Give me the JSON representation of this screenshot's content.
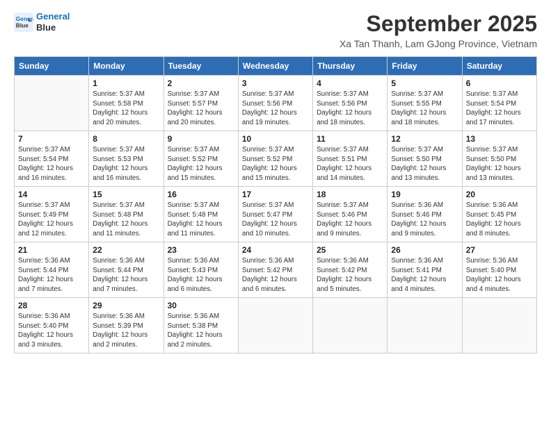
{
  "header": {
    "logo_line1": "General",
    "logo_line2": "Blue",
    "month_title": "September 2025",
    "subtitle": "Xa Tan Thanh, Lam GJong Province, Vietnam"
  },
  "days_of_week": [
    "Sunday",
    "Monday",
    "Tuesday",
    "Wednesday",
    "Thursday",
    "Friday",
    "Saturday"
  ],
  "weeks": [
    [
      {
        "day": "",
        "info": ""
      },
      {
        "day": "1",
        "info": "Sunrise: 5:37 AM\nSunset: 5:58 PM\nDaylight: 12 hours\nand 20 minutes."
      },
      {
        "day": "2",
        "info": "Sunrise: 5:37 AM\nSunset: 5:57 PM\nDaylight: 12 hours\nand 20 minutes."
      },
      {
        "day": "3",
        "info": "Sunrise: 5:37 AM\nSunset: 5:56 PM\nDaylight: 12 hours\nand 19 minutes."
      },
      {
        "day": "4",
        "info": "Sunrise: 5:37 AM\nSunset: 5:56 PM\nDaylight: 12 hours\nand 18 minutes."
      },
      {
        "day": "5",
        "info": "Sunrise: 5:37 AM\nSunset: 5:55 PM\nDaylight: 12 hours\nand 18 minutes."
      },
      {
        "day": "6",
        "info": "Sunrise: 5:37 AM\nSunset: 5:54 PM\nDaylight: 12 hours\nand 17 minutes."
      }
    ],
    [
      {
        "day": "7",
        "info": "Sunrise: 5:37 AM\nSunset: 5:54 PM\nDaylight: 12 hours\nand 16 minutes."
      },
      {
        "day": "8",
        "info": "Sunrise: 5:37 AM\nSunset: 5:53 PM\nDaylight: 12 hours\nand 16 minutes."
      },
      {
        "day": "9",
        "info": "Sunrise: 5:37 AM\nSunset: 5:52 PM\nDaylight: 12 hours\nand 15 minutes."
      },
      {
        "day": "10",
        "info": "Sunrise: 5:37 AM\nSunset: 5:52 PM\nDaylight: 12 hours\nand 15 minutes."
      },
      {
        "day": "11",
        "info": "Sunrise: 5:37 AM\nSunset: 5:51 PM\nDaylight: 12 hours\nand 14 minutes."
      },
      {
        "day": "12",
        "info": "Sunrise: 5:37 AM\nSunset: 5:50 PM\nDaylight: 12 hours\nand 13 minutes."
      },
      {
        "day": "13",
        "info": "Sunrise: 5:37 AM\nSunset: 5:50 PM\nDaylight: 12 hours\nand 13 minutes."
      }
    ],
    [
      {
        "day": "14",
        "info": "Sunrise: 5:37 AM\nSunset: 5:49 PM\nDaylight: 12 hours\nand 12 minutes."
      },
      {
        "day": "15",
        "info": "Sunrise: 5:37 AM\nSunset: 5:48 PM\nDaylight: 12 hours\nand 11 minutes."
      },
      {
        "day": "16",
        "info": "Sunrise: 5:37 AM\nSunset: 5:48 PM\nDaylight: 12 hours\nand 11 minutes."
      },
      {
        "day": "17",
        "info": "Sunrise: 5:37 AM\nSunset: 5:47 PM\nDaylight: 12 hours\nand 10 minutes."
      },
      {
        "day": "18",
        "info": "Sunrise: 5:37 AM\nSunset: 5:46 PM\nDaylight: 12 hours\nand 9 minutes."
      },
      {
        "day": "19",
        "info": "Sunrise: 5:36 AM\nSunset: 5:46 PM\nDaylight: 12 hours\nand 9 minutes."
      },
      {
        "day": "20",
        "info": "Sunrise: 5:36 AM\nSunset: 5:45 PM\nDaylight: 12 hours\nand 8 minutes."
      }
    ],
    [
      {
        "day": "21",
        "info": "Sunrise: 5:36 AM\nSunset: 5:44 PM\nDaylight: 12 hours\nand 7 minutes."
      },
      {
        "day": "22",
        "info": "Sunrise: 5:36 AM\nSunset: 5:44 PM\nDaylight: 12 hours\nand 7 minutes."
      },
      {
        "day": "23",
        "info": "Sunrise: 5:36 AM\nSunset: 5:43 PM\nDaylight: 12 hours\nand 6 minutes."
      },
      {
        "day": "24",
        "info": "Sunrise: 5:36 AM\nSunset: 5:42 PM\nDaylight: 12 hours\nand 6 minutes."
      },
      {
        "day": "25",
        "info": "Sunrise: 5:36 AM\nSunset: 5:42 PM\nDaylight: 12 hours\nand 5 minutes."
      },
      {
        "day": "26",
        "info": "Sunrise: 5:36 AM\nSunset: 5:41 PM\nDaylight: 12 hours\nand 4 minutes."
      },
      {
        "day": "27",
        "info": "Sunrise: 5:36 AM\nSunset: 5:40 PM\nDaylight: 12 hours\nand 4 minutes."
      }
    ],
    [
      {
        "day": "28",
        "info": "Sunrise: 5:36 AM\nSunset: 5:40 PM\nDaylight: 12 hours\nand 3 minutes."
      },
      {
        "day": "29",
        "info": "Sunrise: 5:36 AM\nSunset: 5:39 PM\nDaylight: 12 hours\nand 2 minutes."
      },
      {
        "day": "30",
        "info": "Sunrise: 5:36 AM\nSunset: 5:38 PM\nDaylight: 12 hours\nand 2 minutes."
      },
      {
        "day": "",
        "info": ""
      },
      {
        "day": "",
        "info": ""
      },
      {
        "day": "",
        "info": ""
      },
      {
        "day": "",
        "info": ""
      }
    ]
  ]
}
